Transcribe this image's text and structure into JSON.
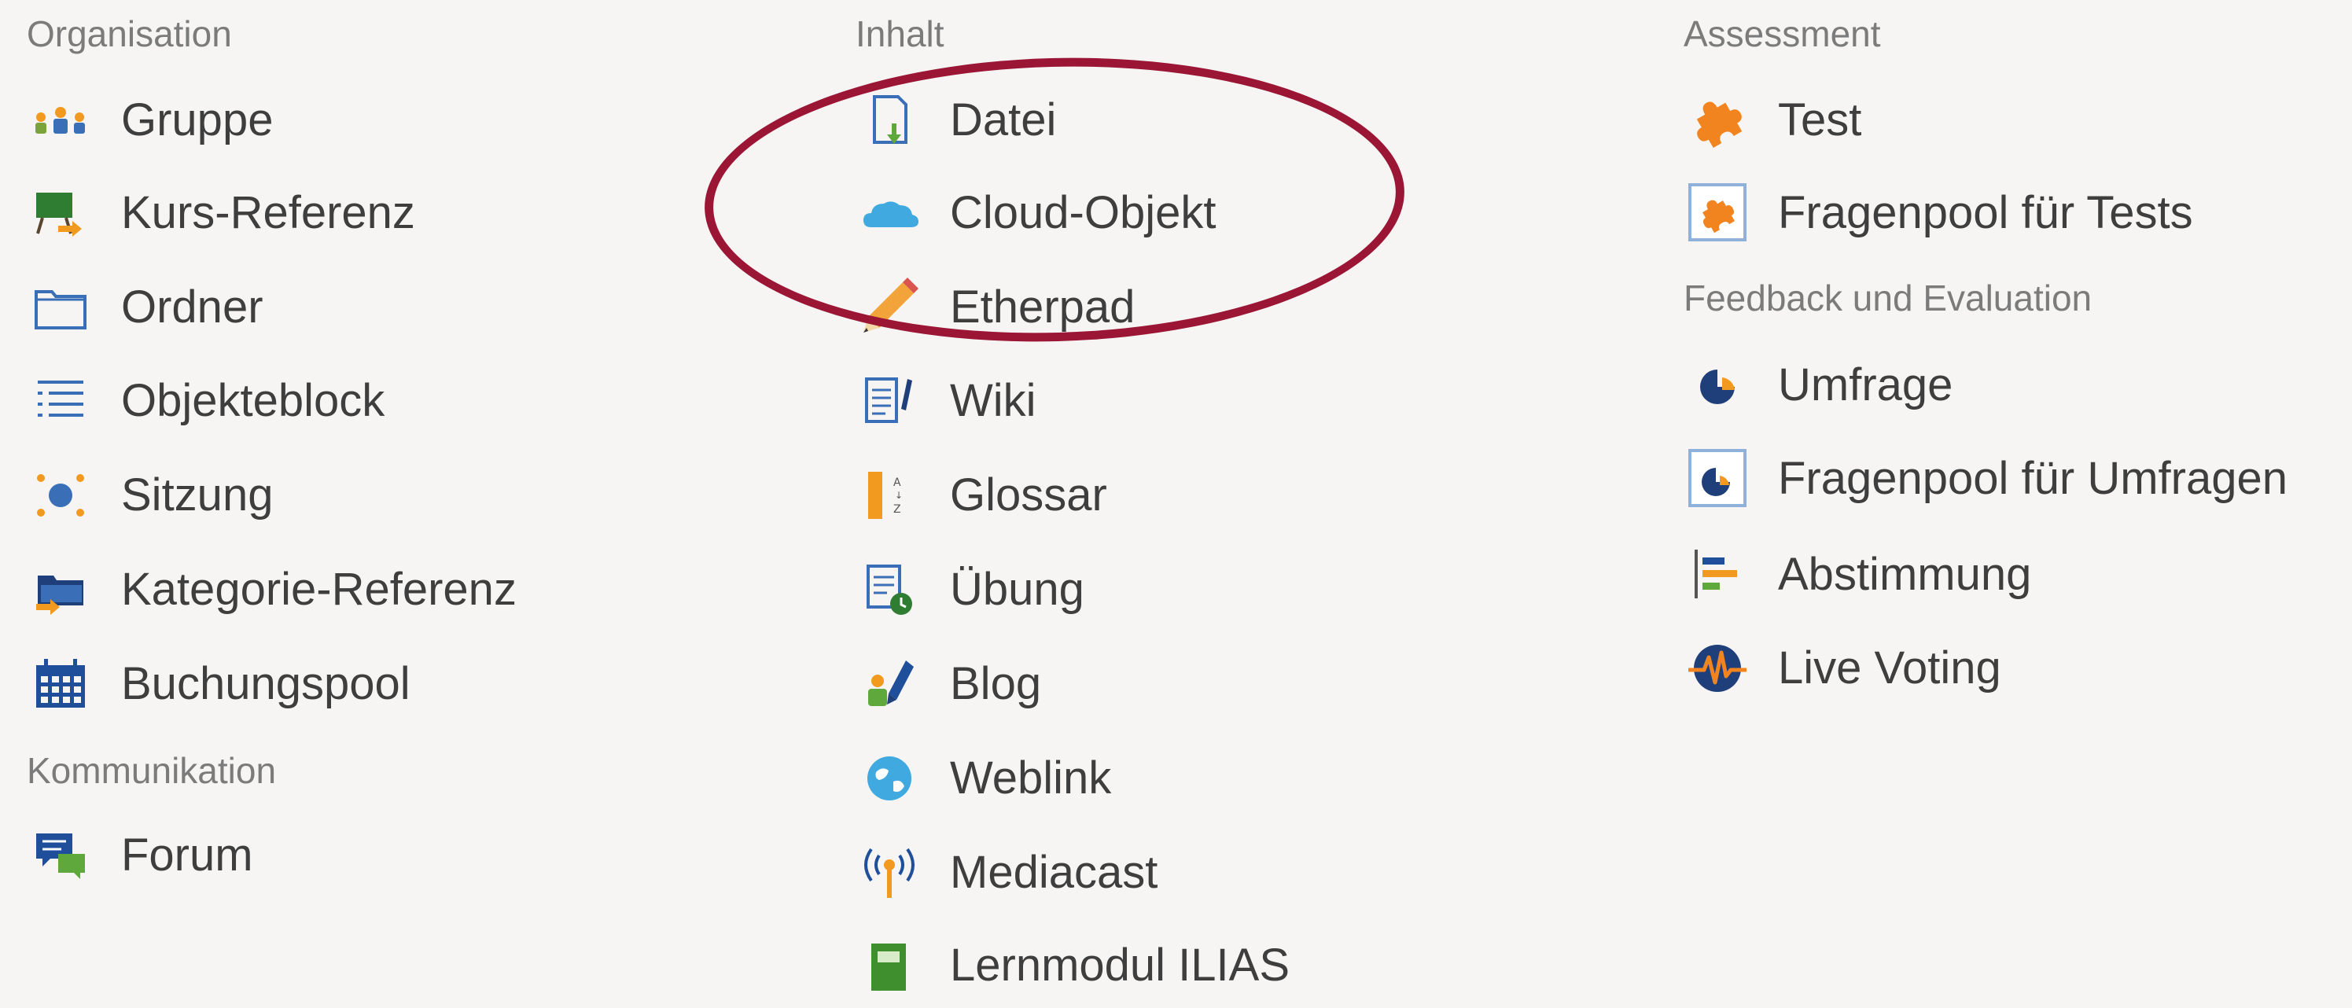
{
  "columns": {
    "organisation": {
      "heading": "Organisation",
      "items": [
        {
          "label": "Gruppe",
          "icon": "group-icon"
        },
        {
          "label": "Kurs-Referenz",
          "icon": "course-reference-icon"
        },
        {
          "label": "Ordner",
          "icon": "folder-icon"
        },
        {
          "label": "Objekteblock",
          "icon": "list-icon"
        },
        {
          "label": "Sitzung",
          "icon": "session-icon"
        },
        {
          "label": "Kategorie-Referenz",
          "icon": "category-reference-icon"
        },
        {
          "label": "Buchungspool",
          "icon": "calendar-icon"
        }
      ]
    },
    "kommunikation": {
      "heading": "Kommunikation",
      "items": [
        {
          "label": "Forum",
          "icon": "forum-icon"
        }
      ]
    },
    "inhalt": {
      "heading": "Inhalt",
      "items": [
        {
          "label": "Datei",
          "icon": "file-icon"
        },
        {
          "label": "Cloud-Objekt",
          "icon": "cloud-icon"
        },
        {
          "label": "Etherpad",
          "icon": "pencil-icon"
        },
        {
          "label": "Wiki",
          "icon": "wiki-icon"
        },
        {
          "label": "Glossar",
          "icon": "glossary-icon"
        },
        {
          "label": "Übung",
          "icon": "exercise-icon"
        },
        {
          "label": "Blog",
          "icon": "blog-icon"
        },
        {
          "label": "Weblink",
          "icon": "weblink-icon"
        },
        {
          "label": "Mediacast",
          "icon": "mediacast-icon"
        },
        {
          "label": "Lernmodul ILIAS",
          "icon": "learning-module-icon"
        }
      ]
    },
    "assessment": {
      "heading": "Assessment",
      "items": [
        {
          "label": "Test",
          "icon": "test-puzzle-icon"
        },
        {
          "label": "Fragenpool für Tests",
          "icon": "question-pool-test-icon"
        }
      ]
    },
    "feedback": {
      "heading": "Feedback und Evaluation",
      "items": [
        {
          "label": "Umfrage",
          "icon": "survey-icon"
        },
        {
          "label": "Fragenpool für Umfragen",
          "icon": "question-pool-survey-icon"
        },
        {
          "label": "Abstimmung",
          "icon": "poll-icon"
        },
        {
          "label": "Live Voting",
          "icon": "live-voting-icon"
        }
      ]
    }
  },
  "annotation": {
    "type": "ellipse",
    "color": "#9b1535",
    "highlights": [
      "Datei",
      "Cloud-Objekt",
      "Etherpad"
    ]
  }
}
